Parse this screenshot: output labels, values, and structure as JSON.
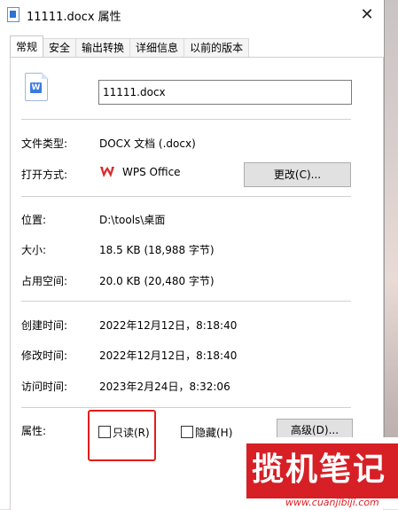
{
  "window": {
    "title": "11111.docx 属性",
    "close_glyph": "✕"
  },
  "tabs": [
    {
      "label": "常规",
      "active": true
    },
    {
      "label": "安全",
      "active": false
    },
    {
      "label": "输出转换",
      "active": false
    },
    {
      "label": "详细信息",
      "active": false
    },
    {
      "label": "以前的版本",
      "active": false
    }
  ],
  "file": {
    "icon_badge": "W",
    "name": "11111.docx"
  },
  "details": {
    "type_label": "文件类型:",
    "type_value": "DOCX 文档 (.docx)",
    "open_label": "打开方式:",
    "open_value": "WPS Office",
    "change_button": "更改(C)...",
    "location_label": "位置:",
    "location_value": "D:\\tools\\桌面",
    "size_label": "大小:",
    "size_value": "18.5 KB (18,988 字节)",
    "disk_label": "占用空间:",
    "disk_value": "20.0 KB (20,480 字节)",
    "created_label": "创建时间:",
    "created_value": "2022年12月12日，8:18:40",
    "modified_label": "修改时间:",
    "modified_value": "2022年12月12日，8:18:40",
    "accessed_label": "访问时间:",
    "accessed_value": "2023年2月24日，8:32:06"
  },
  "attributes": {
    "label": "属性:",
    "readonly_label": "只读(R)",
    "readonly_checked": false,
    "hidden_label": "隐藏(H)",
    "hidden_checked": false,
    "advanced_button": "高级(D)..."
  },
  "watermark": {
    "text": "揽机笔记",
    "url": "www.cuanjibiji.com"
  },
  "colors": {
    "highlight": "#e21d1d",
    "watermark_red": "#d71f26",
    "button_bg": "#e1e1e1"
  }
}
